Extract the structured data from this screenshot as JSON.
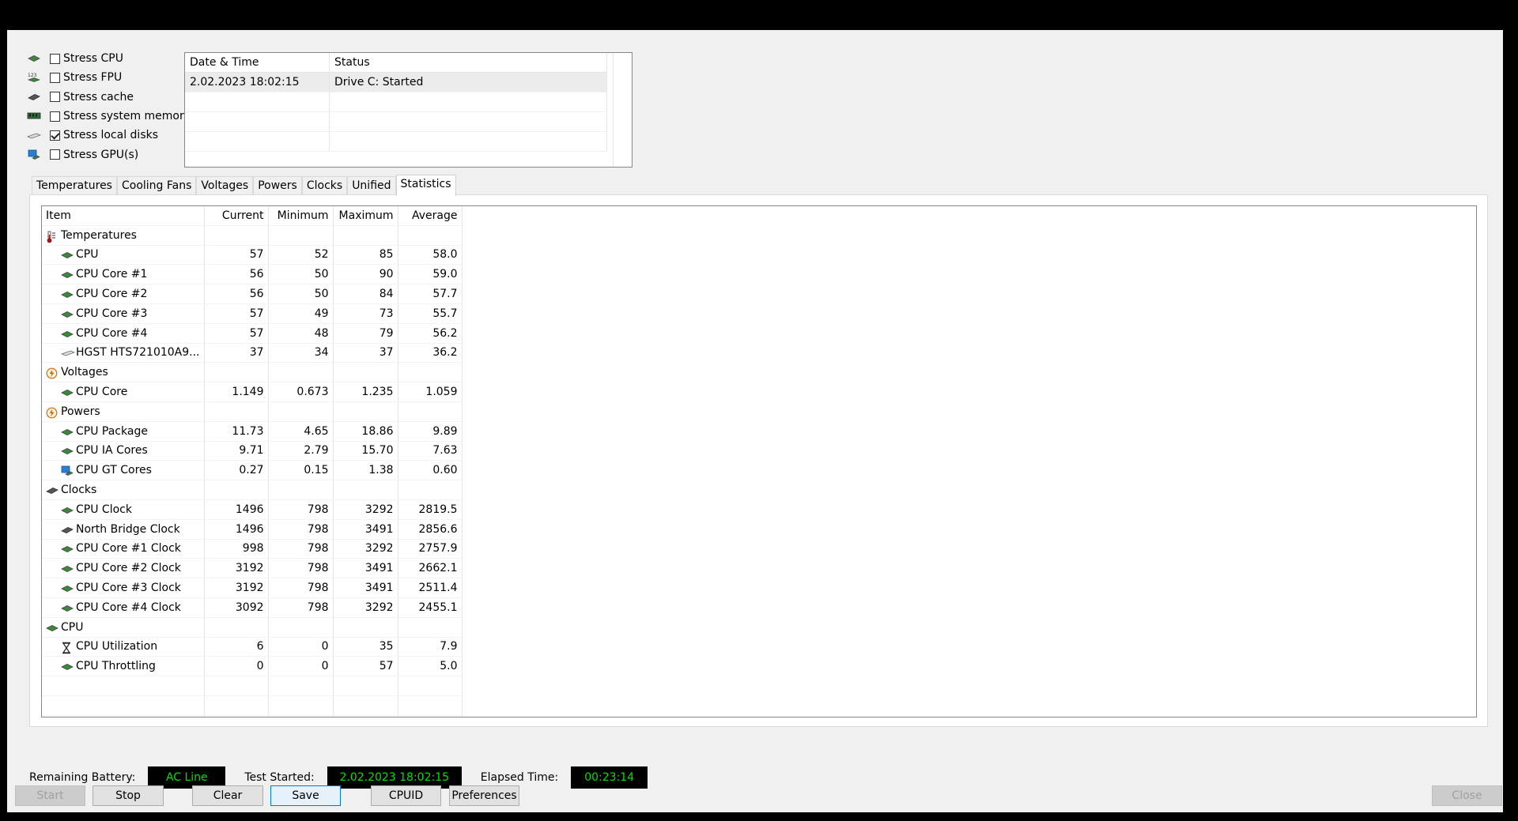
{
  "stress_options": [
    {
      "label": "Stress CPU",
      "checked": false,
      "icon": "cpu-chip-icon"
    },
    {
      "label": "Stress FPU",
      "checked": false,
      "icon": "fpu-123-icon"
    },
    {
      "label": "Stress cache",
      "checked": false,
      "icon": "cache-chip-icon"
    },
    {
      "label": "Stress system memory",
      "checked": false,
      "icon": "memory-module-icon"
    },
    {
      "label": "Stress local disks",
      "checked": true,
      "icon": "hard-disk-icon"
    },
    {
      "label": "Stress GPU(s)",
      "checked": false,
      "icon": "gpu-monitor-icon"
    }
  ],
  "log": {
    "headers": [
      "Date & Time",
      "Status"
    ],
    "rows": [
      {
        "datetime": "2.02.2023 18:02:15",
        "status": "Drive C: Started"
      }
    ]
  },
  "tabs": [
    "Temperatures",
    "Cooling Fans",
    "Voltages",
    "Powers",
    "Clocks",
    "Unified",
    "Statistics"
  ],
  "active_tab": "Statistics",
  "stats": {
    "headers": {
      "item": "Item",
      "current": "Current",
      "minimum": "Minimum",
      "maximum": "Maximum",
      "average": "Average"
    },
    "rows": [
      {
        "type": "group",
        "label": "Temperatures",
        "icon": "thermometer-icon"
      },
      {
        "type": "item",
        "label": "CPU",
        "icon": "cpu-chip-icon",
        "current": "57",
        "minimum": "52",
        "maximum": "85",
        "average": "58.0"
      },
      {
        "type": "item",
        "label": "CPU Core #1",
        "icon": "cpu-chip-icon",
        "current": "56",
        "minimum": "50",
        "maximum": "90",
        "average": "59.0"
      },
      {
        "type": "item",
        "label": "CPU Core #2",
        "icon": "cpu-chip-icon",
        "current": "56",
        "minimum": "50",
        "maximum": "84",
        "average": "57.7"
      },
      {
        "type": "item",
        "label": "CPU Core #3",
        "icon": "cpu-chip-icon",
        "current": "57",
        "minimum": "49",
        "maximum": "73",
        "average": "55.7"
      },
      {
        "type": "item",
        "label": "CPU Core #4",
        "icon": "cpu-chip-icon",
        "current": "57",
        "minimum": "48",
        "maximum": "79",
        "average": "56.2"
      },
      {
        "type": "item",
        "label": "HGST HTS721010A9...",
        "icon": "hard-disk-icon",
        "current": "37",
        "minimum": "34",
        "maximum": "37",
        "average": "36.2"
      },
      {
        "type": "group",
        "label": "Voltages",
        "icon": "voltage-bolt-icon"
      },
      {
        "type": "item",
        "label": "CPU Core",
        "icon": "cpu-chip-icon",
        "current": "1.149",
        "minimum": "0.673",
        "maximum": "1.235",
        "average": "1.059"
      },
      {
        "type": "group",
        "label": "Powers",
        "icon": "power-bolt-icon"
      },
      {
        "type": "item",
        "label": "CPU Package",
        "icon": "cpu-chip-icon",
        "current": "11.73",
        "minimum": "4.65",
        "maximum": "18.86",
        "average": "9.89"
      },
      {
        "type": "item",
        "label": "CPU IA Cores",
        "icon": "cpu-chip-icon",
        "current": "9.71",
        "minimum": "2.79",
        "maximum": "15.70",
        "average": "7.63"
      },
      {
        "type": "item",
        "label": "CPU GT Cores",
        "icon": "gpu-monitor-icon",
        "current": "0.27",
        "minimum": "0.15",
        "maximum": "1.38",
        "average": "0.60"
      },
      {
        "type": "group",
        "label": "Clocks",
        "icon": "clock-chip-icon"
      },
      {
        "type": "item",
        "label": "CPU Clock",
        "icon": "cpu-chip-icon",
        "current": "1496",
        "minimum": "798",
        "maximum": "3292",
        "average": "2819.5"
      },
      {
        "type": "item",
        "label": "North Bridge Clock",
        "icon": "northbridge-chip-icon",
        "current": "1496",
        "minimum": "798",
        "maximum": "3491",
        "average": "2856.6"
      },
      {
        "type": "item",
        "label": "CPU Core #1 Clock",
        "icon": "cpu-chip-icon",
        "current": "998",
        "minimum": "798",
        "maximum": "3292",
        "average": "2757.9"
      },
      {
        "type": "item",
        "label": "CPU Core #2 Clock",
        "icon": "cpu-chip-icon",
        "current": "3192",
        "minimum": "798",
        "maximum": "3491",
        "average": "2662.1"
      },
      {
        "type": "item",
        "label": "CPU Core #3 Clock",
        "icon": "cpu-chip-icon",
        "current": "3192",
        "minimum": "798",
        "maximum": "3491",
        "average": "2511.4"
      },
      {
        "type": "item",
        "label": "CPU Core #4 Clock",
        "icon": "cpu-chip-icon",
        "current": "3092",
        "minimum": "798",
        "maximum": "3292",
        "average": "2455.1"
      },
      {
        "type": "group",
        "label": "CPU",
        "icon": "cpu-chip-icon"
      },
      {
        "type": "item",
        "label": "CPU Utilization",
        "icon": "hourglass-icon",
        "current": "6",
        "minimum": "0",
        "maximum": "35",
        "average": "7.9"
      },
      {
        "type": "item",
        "label": "CPU Throttling",
        "icon": "cpu-chip-icon",
        "current": "0",
        "minimum": "0",
        "maximum": "57",
        "average": "5.0"
      }
    ]
  },
  "status_bar": {
    "battery_label": "Remaining Battery:",
    "battery_value": "AC Line",
    "started_label": "Test Started:",
    "started_value": "2.02.2023 18:02:15",
    "elapsed_label": "Elapsed Time:",
    "elapsed_value": "00:23:14",
    "lcd_text_color": "#00e000"
  },
  "buttons": {
    "start": "Start",
    "stop": "Stop",
    "clear": "Clear",
    "save": "Save",
    "cpuid": "CPUID",
    "preferences": "Preferences",
    "close": "Close"
  }
}
